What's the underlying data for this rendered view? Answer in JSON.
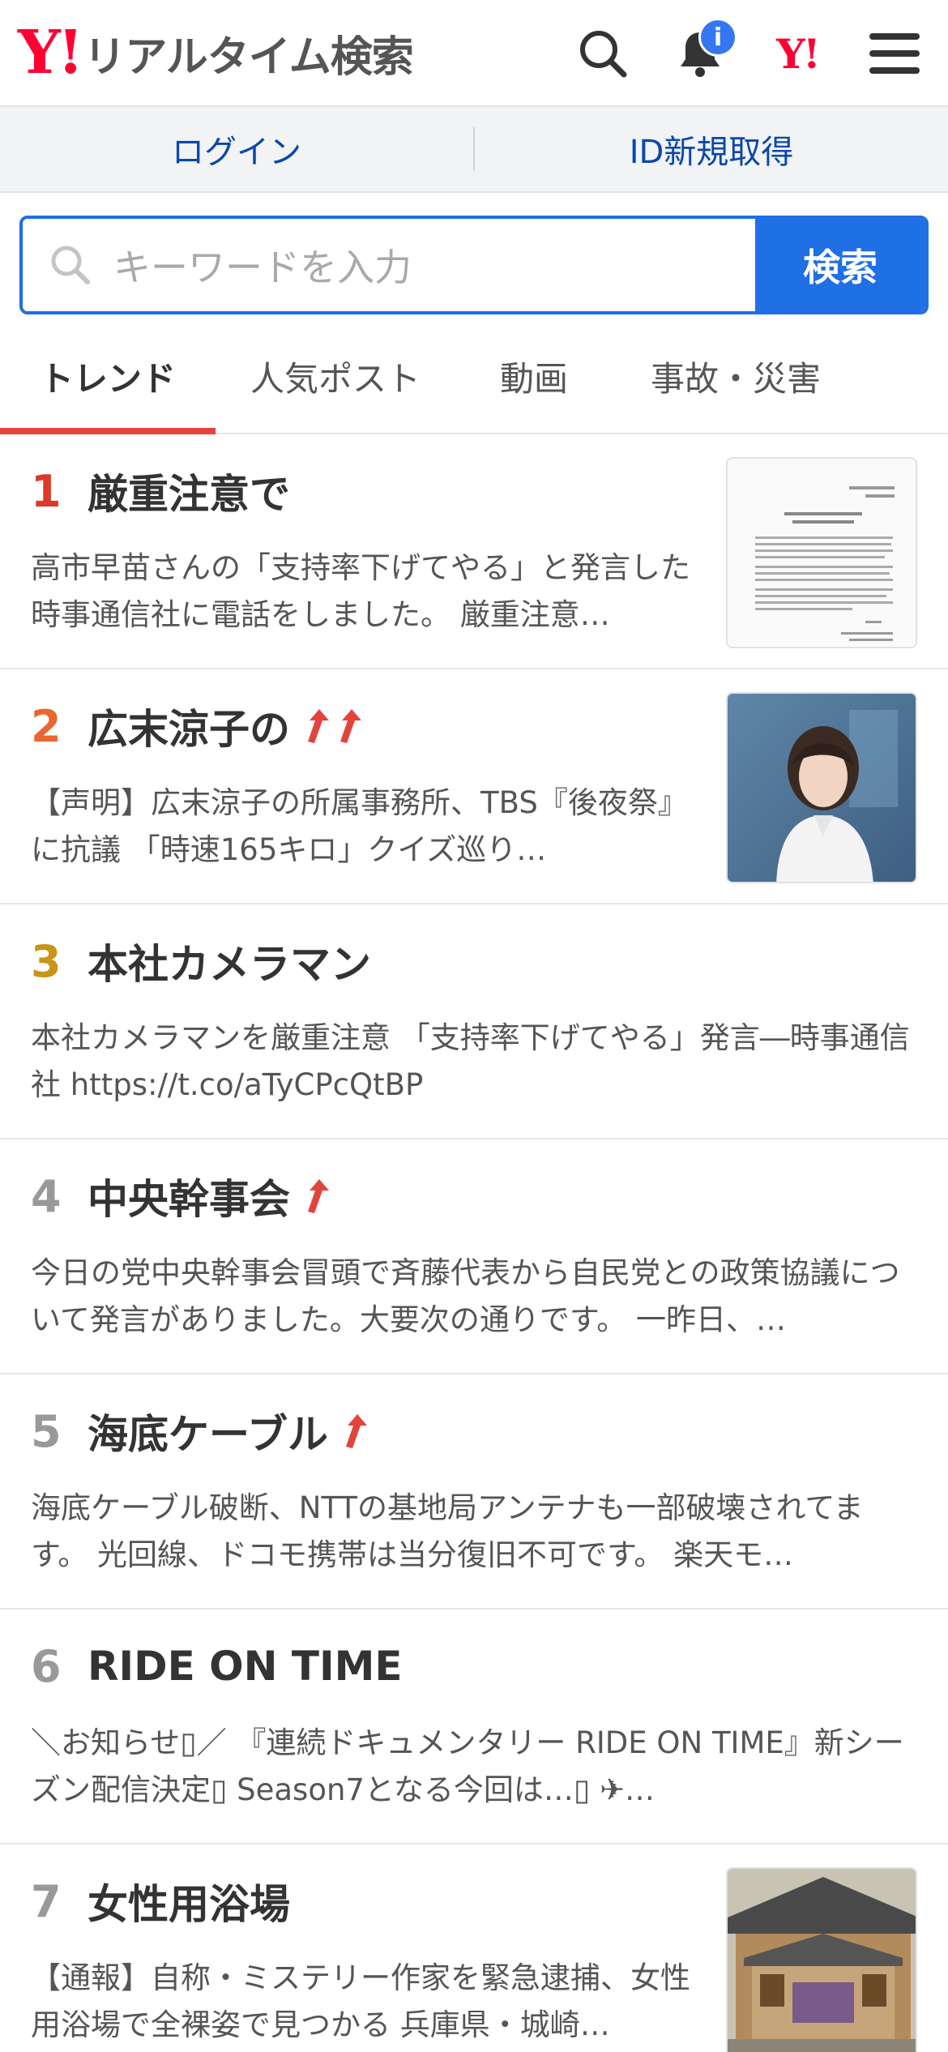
{
  "header": {
    "logo_mark": "Y!",
    "logo_text": "リアルタイム検索",
    "notification_badge": "i",
    "yj_mark": "Y!"
  },
  "account": {
    "login": "ログイン",
    "signup": "ID新規取得"
  },
  "search": {
    "placeholder": "キーワードを入力",
    "button": "検索"
  },
  "tabs": [
    {
      "label": "トレンド",
      "active": true
    },
    {
      "label": "人気ポスト",
      "active": false
    },
    {
      "label": "動画",
      "active": false
    },
    {
      "label": "事故・災害",
      "active": false
    }
  ],
  "colors": {
    "rank1": "#d93a2b",
    "rank2": "#e8662f",
    "rank3": "#c99419",
    "rank_other": "#999999",
    "accent_blue": "#1f6fe5",
    "tab_underline": "#e2443c",
    "arrow": "#e2443c"
  },
  "trends": [
    {
      "rank": "1",
      "keyword": "厳重注意で",
      "arrows": 0,
      "description": "高市早苗さんの「支持率下げてやる」と発言した時事通信社に電話をしました。 厳重注意…",
      "thumbnail": "document"
    },
    {
      "rank": "2",
      "keyword": "広末涼子の",
      "arrows": 2,
      "description": "【声明】広末涼子の所属事務所、TBS『後夜祭』に抗議 「時速165キロ」クイズ巡り…",
      "thumbnail": "portrait"
    },
    {
      "rank": "3",
      "keyword": "本社カメラマン",
      "arrows": 0,
      "description": "本社カメラマンを厳重注意 「支持率下げてやる」発言―時事通信社 https://t.co/aTyCPcQtBP",
      "thumbnail": null
    },
    {
      "rank": "4",
      "keyword": "中央幹事会",
      "arrows": 1,
      "description": "今日の党中央幹事会冒頭で斉藤代表から自民党との政策協議について発言がありました。大要次の通りです。 一昨日、…",
      "thumbnail": null
    },
    {
      "rank": "5",
      "keyword": "海底ケーブル",
      "arrows": 1,
      "description": "海底ケーブル破断、NTTの基地局アンテナも一部破壊されてます。 光回線、ドコモ携帯は当分復旧不可です。 楽天モ…",
      "thumbnail": null
    },
    {
      "rank": "6",
      "keyword": "RIDE ON TIME",
      "arrows": 0,
      "description": "＼お知らせ▯／ 『連続ドキュメンタリー RIDE ON TIME』新シーズン配信決定▯ Season7となる今回は…▯ ✈…",
      "thumbnail": null
    },
    {
      "rank": "7",
      "keyword": "女性用浴場",
      "arrows": 0,
      "description": "【通報】自称・ミステリー作家を緊急逮捕、女性用浴場で全裸姿で見つかる 兵庫県・城崎…",
      "thumbnail": "building"
    }
  ]
}
